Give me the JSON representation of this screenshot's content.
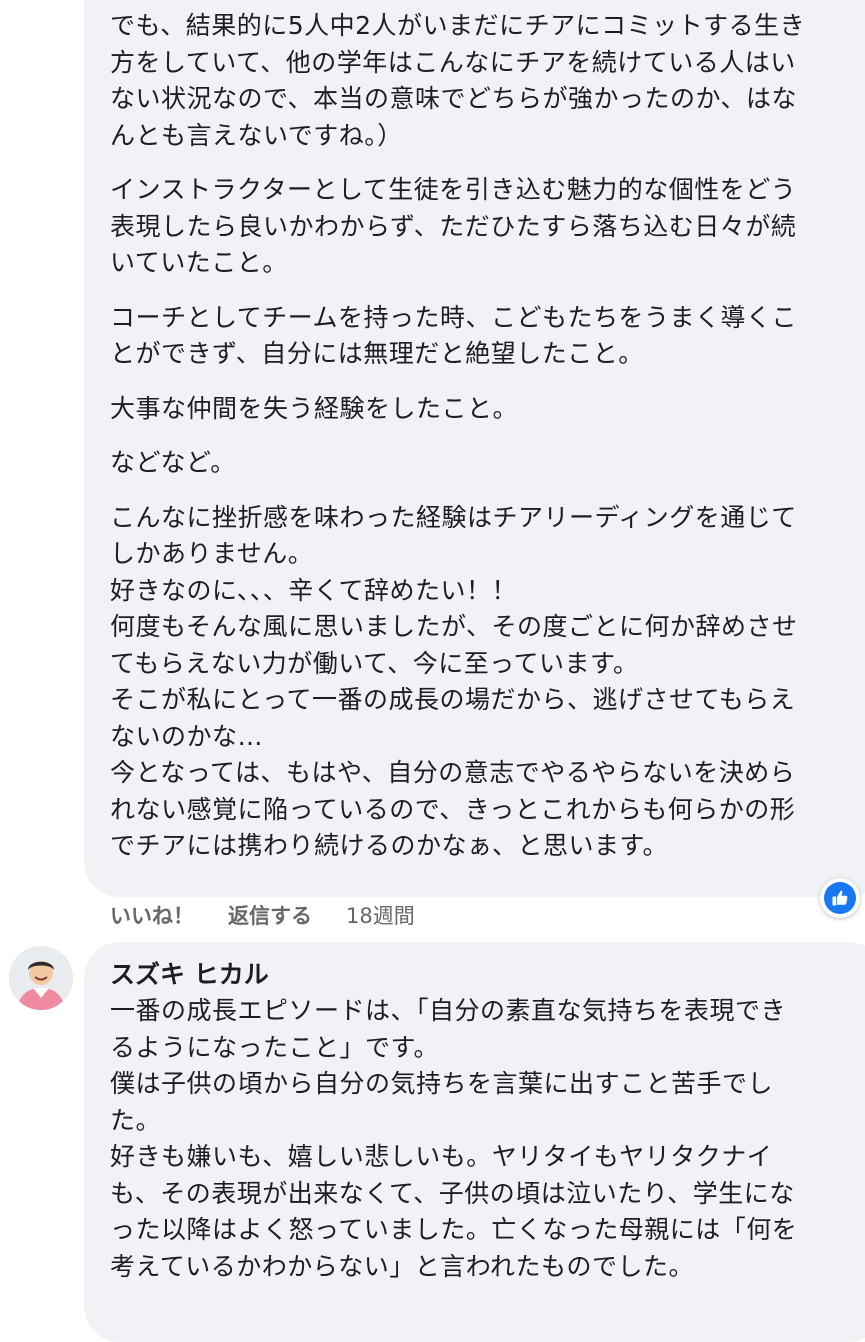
{
  "colors": {
    "bubble_bg": "#f0f2f5",
    "text": "#1c1e21",
    "meta_text": "#65676b",
    "like_blue": "#1877f2"
  },
  "comment1": {
    "paragraphs": [
      "でも、結果的に5人中2人がいまだにチアにコミットする生き\n方をしていて、他の学年はこんなにチアを続けている人はい\nない状況なので、本当の意味でどちらが強かったのか、はな\nんとも言えないですね。）",
      "インストラクターとして生徒を引き込む魅力的な個性をどう\n表現したら良いかわからず、ただひたすら落ち込む日々が続\nいていたこと。",
      "コーチとしてチームを持った時、こどもたちをうまく導くこ\nとができず、自分には無理だと絶望したこと。",
      "大事な仲間を失う経験をしたこと。",
      "などなど。",
      "こんなに挫折感を味わった経験はチアリーディングを通じて\nしかありません。\n好きなのに、、、辛くて辞めたい！！\n何度もそんな風に思いましたが、その度ごとに何か辞めさせ\nてもらえない力が働いて、今に至っています。\nそこが私にとって一番の成長の場だから、逃げさせてもらえ\nないのかな…\n今となっては、もはや、自分の意志でやるやらないを決めら\nれない感覚に陥っているので、きっとこれからも何らかの形\nでチアには携わり続けるのかなぁ、と思います。"
    ],
    "actions": {
      "like_label": "いいね！",
      "reply_label": "返信する",
      "time": "18週間"
    },
    "reaction_icon": "thumbs-up-icon"
  },
  "comment2": {
    "author": "スズキ ヒカル",
    "avatar_icon": "user-avatar",
    "text": "一番の成長エピソードは、「自分の素直な気持ちを表現でき\nるようになったこと」です。\n僕は子供の頃から自分の気持ちを言葉に出すこと苦手でし\nた。\n好きも嫌いも、嬉しい悲しいも。ヤリタイもヤリタクナイ\nも、その表現が出来なくて、子供の頃は泣いたり、学生にな\nった以降はよく怒っていました。亡くなった母親には「何を\n考えているかわからない」と言われたものでした。"
  }
}
